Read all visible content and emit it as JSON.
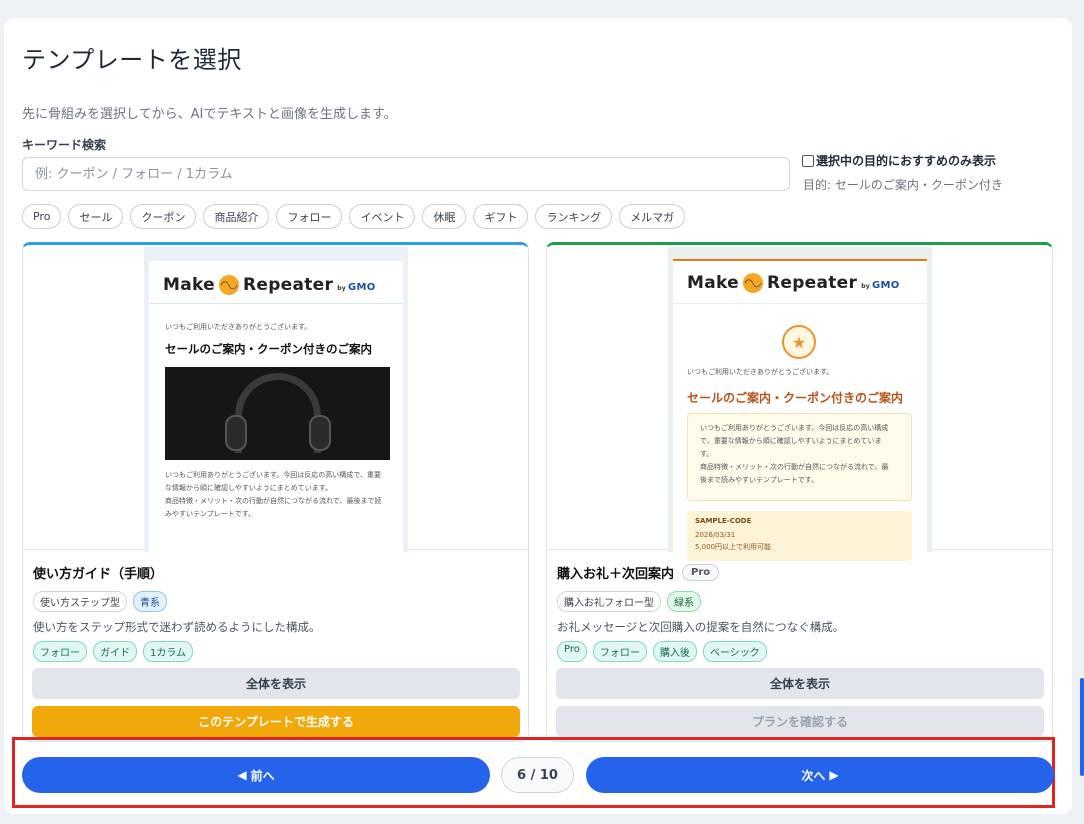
{
  "header": {
    "title": "テンプレートを選択",
    "subtitle": "先に骨組みを選択してから、AIでテキストと画像を生成します。"
  },
  "search": {
    "label": "キーワード検索",
    "placeholder": "例: クーポン / フォロー / 1カラム",
    "value": ""
  },
  "recommend": {
    "checkbox_label": "選択中の目的におすすめのみ表示",
    "checked": false,
    "purpose_text": "目的: セールのご案内・クーポン付き"
  },
  "filter_chips": [
    "Pro",
    "セール",
    "クーポン",
    "商品紹介",
    "フォロー",
    "イベント",
    "休眠",
    "ギフト",
    "ランキング",
    "メルマガ"
  ],
  "cards": [
    {
      "accent_color": "#2aa0e8",
      "preview": {
        "logo_text": "Make",
        "logo_text2": "Repeater",
        "logo_by": "by",
        "logo_brand": "GMO",
        "greeting": "いつもご利用いただきありがとうございます。",
        "heading": "セールのご案内・クーポン付きのご案内",
        "body_line1": "いつもご利用ありがとうございます。今回は反応の高い構成で、重要",
        "body_line2": "な情報から順に確認しやすいようにまとめています。",
        "body_line3": "商品特徴・メリット・次の行動が自然につながる流れで、最後まで読",
        "body_line4": "みやすいテンプレートです。"
      },
      "title": "使い方ガイド（手順）",
      "type_tag": "使い方ステップ型",
      "color_tag": "青系",
      "description": "使い方をステップ形式で迷わず読めるようにした構成。",
      "tags": [
        "フォロー",
        "ガイド",
        "1カラム"
      ],
      "view_button": "全体を表示",
      "action_button": "このテンプレートで生成する"
    },
    {
      "accent_color": "#1f9d4a",
      "preview": {
        "logo_text": "Make",
        "logo_text2": "Repeater",
        "logo_by": "by",
        "logo_brand": "GMO",
        "greeting": "いつもご利用いただきありがとうございます。",
        "heading": "セールのご案内・クーポン付きのご案内",
        "note_line1": "いつもご利用ありがとうございます。今回は反応の高い構成",
        "note_line2": "で、重要な情報から順に確認しやすいようにまとめていま",
        "note_line3": "す。",
        "note_line4": "商品特徴・メリット・次の行動が自然につながる流れで、最",
        "note_line5": "後まで読みやすいテンプレートです。",
        "code": "SAMPLE-CODE",
        "code_date": "2026/03/31",
        "code_cond": "5,000円以上で利用可能"
      },
      "title": "購入お礼＋次回案内",
      "pro_badge": "Pro",
      "type_tag": "購入お礼フォロー型",
      "color_tag": "緑系",
      "description": "お礼メッセージと次回購入の提案を自然につなぐ構成。",
      "tags": [
        "Pro",
        "フォロー",
        "購入後",
        "ベーシック"
      ],
      "view_button": "全体を表示",
      "action_button": "プランを確認する"
    }
  ],
  "pager": {
    "prev_label": "前へ",
    "prev_icon": "triangle-left-icon",
    "next_label": "次へ",
    "next_icon": "triangle-right-icon",
    "indicator": "6 / 10"
  },
  "colors": {
    "primary": "#2563eb",
    "generate": "#f0a80a",
    "highlight": "#e02424"
  }
}
